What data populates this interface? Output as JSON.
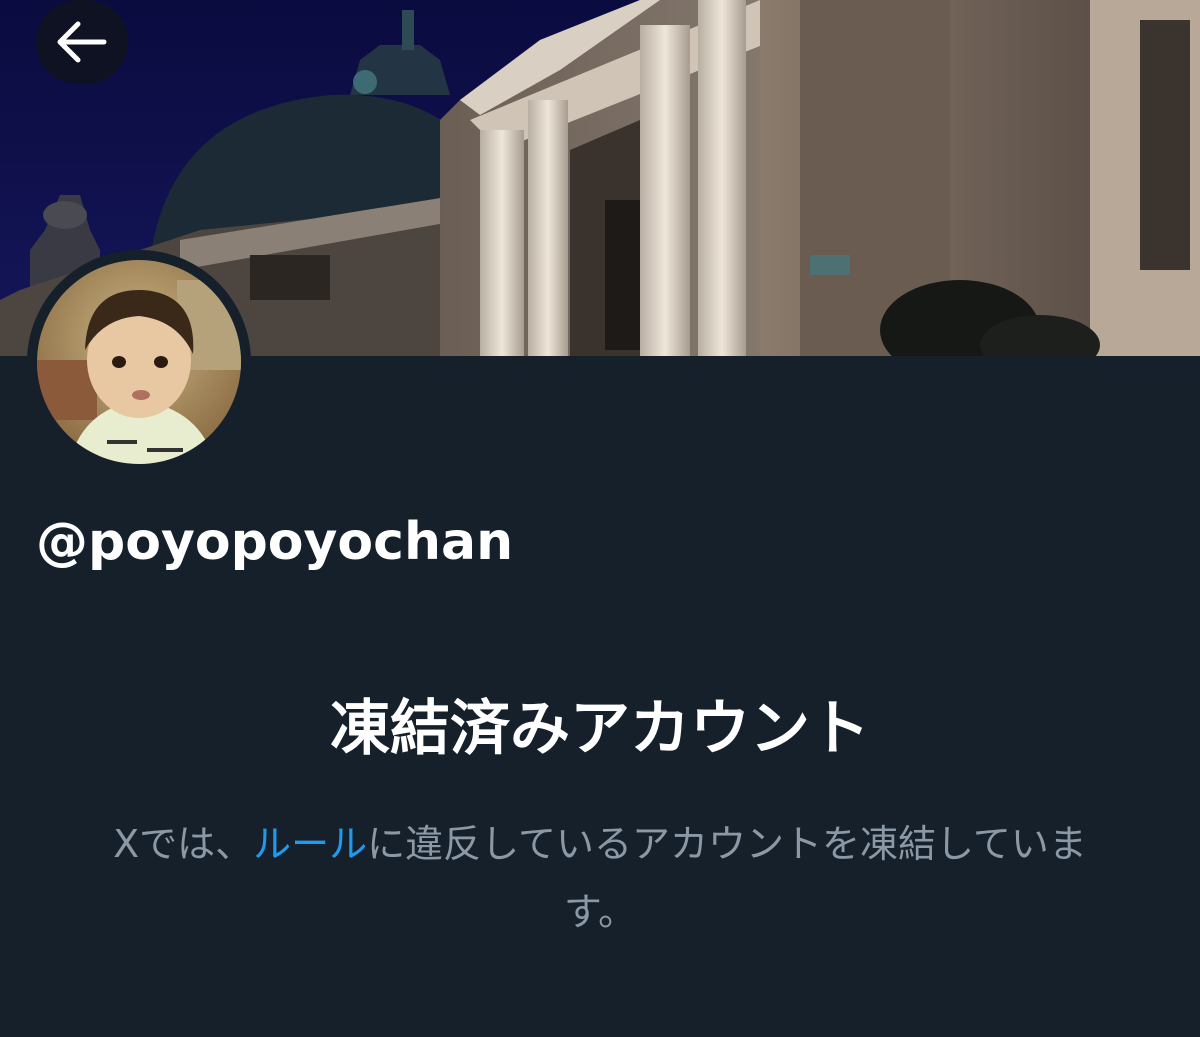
{
  "header": {
    "back_icon": "arrow-left-icon",
    "banner_image": "night-building-banner"
  },
  "profile": {
    "avatar_image": "child-portrait-avatar",
    "handle": "@poyopoyochan"
  },
  "suspension": {
    "title": "凍結済みアカウント",
    "message_prefix": "Xでは、",
    "rules_link": "ルール",
    "message_suffix": "に違反しているアカウントを凍結しています。"
  },
  "colors": {
    "background": "#15202b",
    "primary_text": "#ffffff",
    "secondary_text": "#8b98a5",
    "link": "#1d9bf0"
  }
}
